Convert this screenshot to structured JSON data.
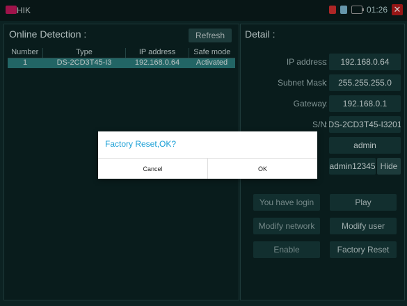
{
  "app": {
    "title": "HIK",
    "time": "01:26"
  },
  "colors": {
    "dialog_text": "#1a9fd6",
    "selected_row": "#2a7c7c",
    "close": "#b71c1c"
  },
  "icons": {
    "logo": "hik-logo-icon",
    "status": [
      "battery-status-icon",
      "network-icon",
      "battery-icon"
    ],
    "close": "close-icon"
  },
  "left": {
    "title": "Online Detection :",
    "refresh": "Refresh",
    "columns": [
      "Number",
      "Type",
      "IP address",
      "Safe mode"
    ],
    "rows": [
      [
        "1",
        "DS-2CD3T45-I3",
        "192.168.0.64",
        "Activated"
      ]
    ]
  },
  "right": {
    "title": "Detail :",
    "fields": [
      {
        "label": "IP address",
        "value": "192.168.0.64"
      },
      {
        "label": "Subnet Mask",
        "value": "255.255.255.0"
      },
      {
        "label": "Gateway",
        "value": "192.168.0.1"
      },
      {
        "label": "S/N",
        "value": "DS-2CD3T45-I3201"
      },
      {
        "label": "",
        "value": "admin"
      },
      {
        "label": "",
        "value": "admin12345"
      }
    ],
    "hide": "Hide",
    "buttons": {
      "login": "You have login",
      "play": "Play",
      "modify_network": "Modify network",
      "modify_user": "Modify user",
      "enable": "Enable",
      "factory_reset": "Factory Reset"
    }
  },
  "dialog": {
    "message": "Factory Reset,OK?",
    "cancel": "Cancel",
    "ok": "OK"
  }
}
